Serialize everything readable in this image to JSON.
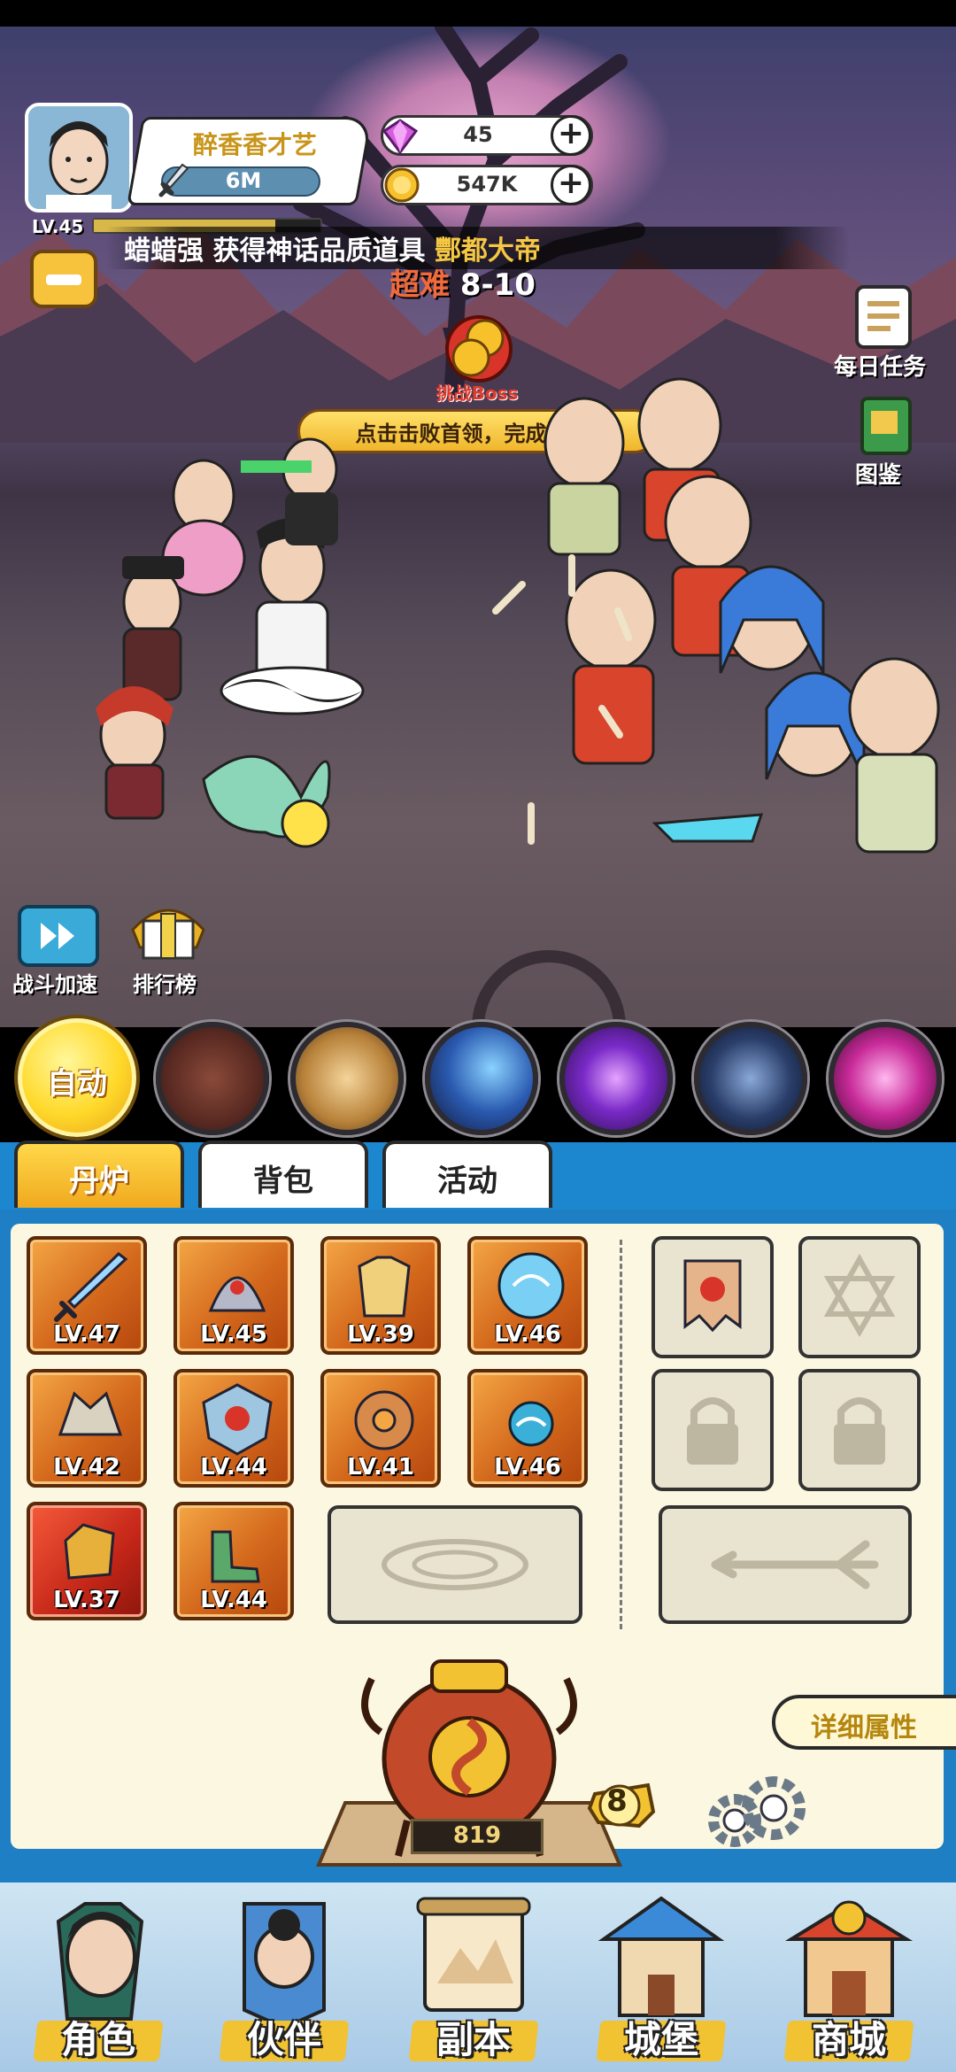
{
  "player": {
    "name": "醉香香才艺",
    "power": "6M",
    "level": "LV.45",
    "xp_fraction": 0.8
  },
  "resources": {
    "gems": "45",
    "gold": "547K"
  },
  "ticker": {
    "user": "蜡蜡强",
    "message": " 获得神话品质道具 ",
    "item": "酆都大帝"
  },
  "stage": {
    "difficulty": "超难",
    "stage": " 8-10",
    "boss_label": "挑战Boss",
    "hint": "点击击败首领，完成通关!"
  },
  "side_buttons": {
    "daily_tasks": "每日任务",
    "codex": "图鉴"
  },
  "battle_controls": {
    "speed_up": "战斗加速",
    "leaderboard": "排行榜"
  },
  "skills": {
    "auto": "自动",
    "icons": [
      "wolf-skill-icon",
      "golden-guardian-skill-icon",
      "blue-comet-skill-icon",
      "purple-vortex-skill-icon",
      "lightning-slab-skill-icon",
      "pink-spiral-skill-icon"
    ]
  },
  "tabs": {
    "furnace": "丹炉",
    "backpack": "背包",
    "events": "活动"
  },
  "equipment": [
    {
      "icon": "sword-icon",
      "level": "LV.47"
    },
    {
      "icon": "helmet-icon",
      "level": "LV.45"
    },
    {
      "icon": "armor-icon",
      "level": "LV.39"
    },
    {
      "icon": "crystal-orb-icon",
      "level": "LV.46"
    },
    {
      "icon": "shoulder-guard-icon",
      "level": "LV.42"
    },
    {
      "icon": "shield-icon",
      "level": "LV.44"
    },
    {
      "icon": "jade-ring-icon",
      "level": "LV.41"
    },
    {
      "icon": "water-orb-icon",
      "level": "LV.46"
    },
    {
      "icon": "gauntlet-icon",
      "level": "LV.37"
    },
    {
      "icon": "boots-icon",
      "level": "LV.44"
    }
  ],
  "detail_button": "详细属性",
  "furnace": {
    "count": "819",
    "level": "8"
  },
  "nav": {
    "character": "角色",
    "partner": "伙伴",
    "dungeon": "副本",
    "castle": "城堡",
    "shop": "商城"
  },
  "colors": {
    "panel_bg": "#fbf7e0",
    "frame_blue": "#1f7fc4",
    "gold": "#f1c232",
    "equip_orange": "#d3681c",
    "equip_red": "#c42618"
  }
}
